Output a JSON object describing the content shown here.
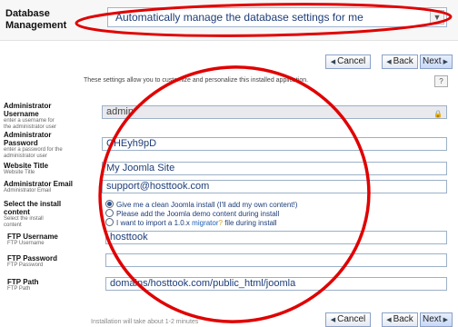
{
  "db_management": {
    "label_line1": "Database",
    "label_line2": "Management",
    "selected_value": "Automatically manage the database settings for me"
  },
  "nav": {
    "cancel": "Cancel",
    "back": "Back",
    "next": "Next"
  },
  "intro_text": "These settings allow you to customize and personalize this installed application.",
  "help_button": "?",
  "fields": {
    "admin_username": {
      "label1": "Administrator",
      "label2": "Username",
      "desc1": "enter a username for",
      "desc2": "the administrator user",
      "value": "admin"
    },
    "admin_password": {
      "label1": "Administrator",
      "label2": "Password",
      "desc1": "enter a password for the",
      "desc2": "administrator user",
      "value": "CHEyh9pD"
    },
    "website_title": {
      "label": "Website Title",
      "desc": "Website Title",
      "value": "My Joomla Site"
    },
    "admin_email": {
      "label": "Administrator Email",
      "desc": "Administrator Email",
      "value": "support@hosttook.com"
    },
    "install_content": {
      "label1": "Select the install",
      "label2": "content",
      "desc1": "Select the install",
      "desc2": "content",
      "options": [
        "Give me a clean Joomla install (I'll add my own content!)",
        "Please add the Joomla demo content during install",
        "I want to import a 1.0.x"
      ],
      "option3_link": "migrator",
      "option3_suffix": "file during install",
      "option3_help": "?"
    },
    "ftp_username": {
      "label": "FTP Username",
      "desc": "FTP Username",
      "value": "hosttook"
    },
    "ftp_password": {
      "label": "FTP Password",
      "desc": "FTP Password",
      "value": ""
    },
    "ftp_path": {
      "label": "FTP Path",
      "desc": "FTP Path",
      "value": "domains/hosttook.com/public_html/joomla"
    }
  },
  "footer_note": "Installation will take about 1-2 minutes",
  "colors": {
    "annotation": "#e00000",
    "link": "#1d5db5",
    "accent": "#1d3d78"
  }
}
